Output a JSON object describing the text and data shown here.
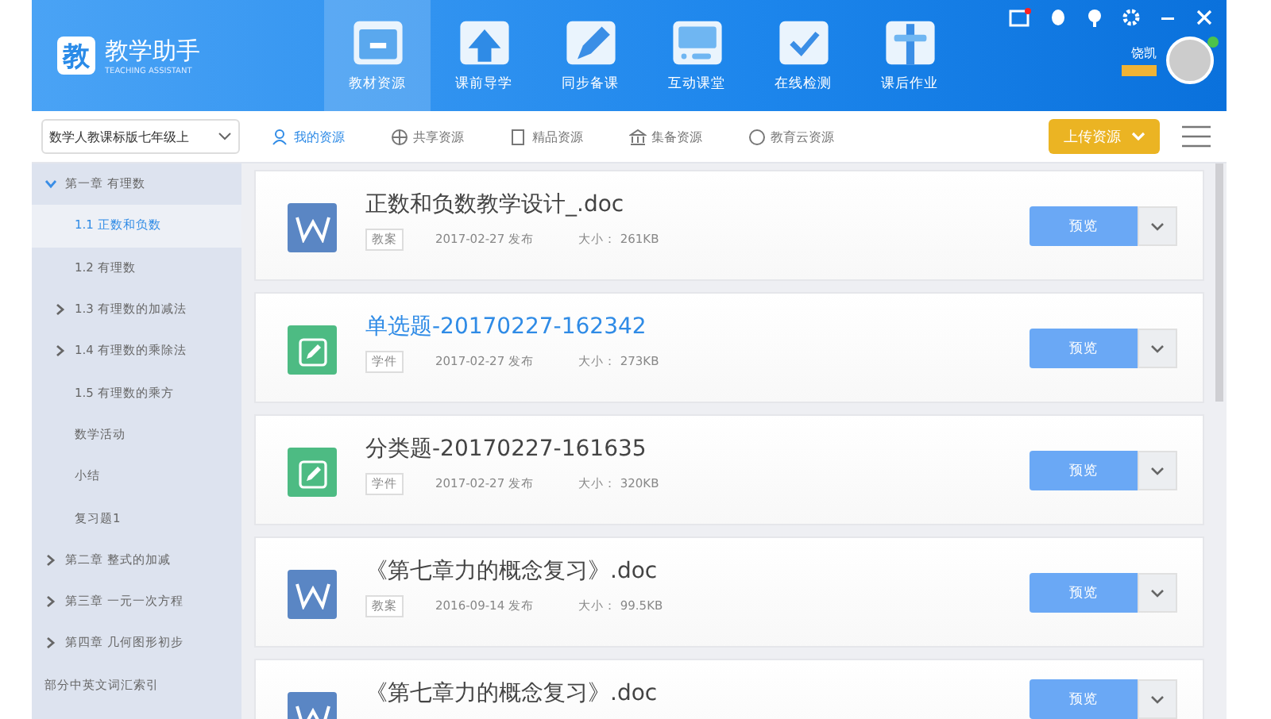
{
  "app": {
    "logo_char": "教",
    "name": "教学助手",
    "subtitle": "TEACHING ASSISTANT"
  },
  "nav": [
    {
      "label": "教材资源",
      "selected": true
    },
    {
      "label": "课前导学",
      "selected": false
    },
    {
      "label": "同步备课",
      "selected": false
    },
    {
      "label": "互动课堂",
      "selected": false
    },
    {
      "label": "在线检测",
      "selected": false
    },
    {
      "label": "课后作业",
      "selected": false
    }
  ],
  "user": {
    "name": "饶凯",
    "online": true,
    "has_message": true
  },
  "textbook_select": {
    "value": "数学人教课标版七年级上"
  },
  "resource_tabs": [
    {
      "label": "我的资源",
      "selected": true
    },
    {
      "label": "共享资源",
      "selected": false
    },
    {
      "label": "精品资源",
      "selected": false
    },
    {
      "label": "集备资源",
      "selected": false
    },
    {
      "label": "教育云资源",
      "selected": false
    }
  ],
  "upload_button": "上传资源",
  "tree": [
    {
      "label": "第一章 有理数",
      "expanded": true,
      "selected": false,
      "children": [
        {
          "label": "1.1 正数和负数",
          "selected": true,
          "has_children": false
        },
        {
          "label": "1.2 有理数",
          "selected": false,
          "has_children": false
        },
        {
          "label": "1.3 有理数的加减法",
          "selected": false,
          "has_children": true
        },
        {
          "label": "1.4 有理数的乘除法",
          "selected": false,
          "has_children": true
        },
        {
          "label": "1.5 有理数的乘方",
          "selected": false,
          "has_children": false
        },
        {
          "label": "数学活动",
          "selected": false,
          "has_children": false
        },
        {
          "label": "小结",
          "selected": false,
          "has_children": false
        },
        {
          "label": "复习题1",
          "selected": false,
          "has_children": false
        }
      ]
    },
    {
      "label": "第二章 整式的加减",
      "expanded": false,
      "selected": false,
      "has_children": true
    },
    {
      "label": "第三章 一元一次方程",
      "expanded": false,
      "selected": false,
      "has_children": true
    },
    {
      "label": "第四章 几何图形初步",
      "expanded": false,
      "selected": false,
      "has_children": true
    },
    {
      "label": "部分中英文词汇索引",
      "expanded": false,
      "selected": false,
      "has_children": false
    }
  ],
  "resources": [
    {
      "kind": "word",
      "title": "正数和负数教学设计_.doc",
      "tag": "教案",
      "date": "2017-02-27 发布",
      "size": "大小： 261KB",
      "highlighted": false,
      "preview": "预览"
    },
    {
      "kind": "exercise",
      "title": "单选题-20170227-162342",
      "tag": "学件",
      "date": "2017-02-27 发布",
      "size": "大小： 273KB",
      "highlighted": true,
      "preview": "预览"
    },
    {
      "kind": "exercise",
      "title": "分类题-20170227-161635",
      "tag": "学件",
      "date": "2017-02-27 发布",
      "size": "大小： 320KB",
      "highlighted": false,
      "preview": "预览"
    },
    {
      "kind": "word",
      "title": "《第七章力的概念复习》.doc",
      "tag": "教案",
      "date": "2016-09-14 发布",
      "size": "大小： 99.5KB",
      "highlighted": false,
      "preview": "预览"
    },
    {
      "kind": "word",
      "title": "《第七章力的概念复习》.doc",
      "highlighted": false,
      "preview": "预览"
    }
  ]
}
